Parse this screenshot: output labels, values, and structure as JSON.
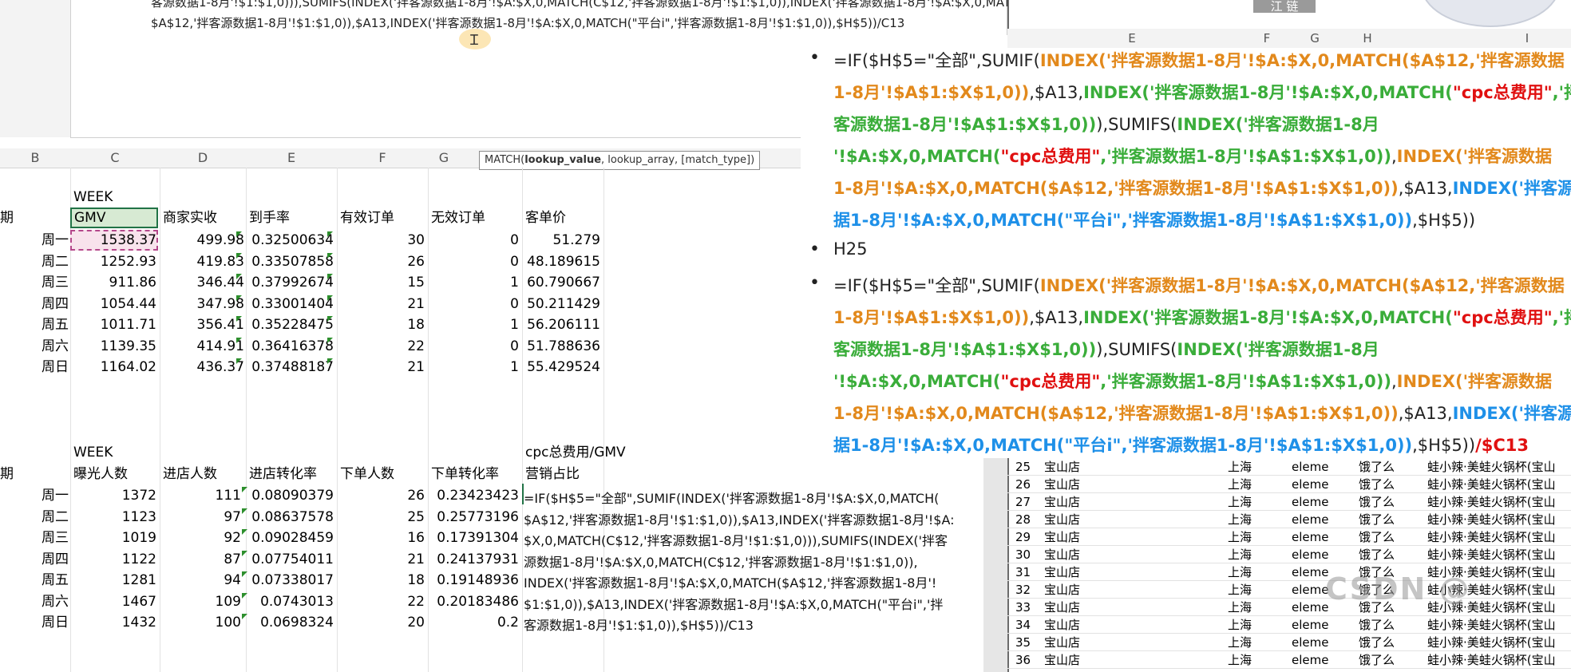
{
  "formula_bar": {
    "line1": "客源数据1-8月'!$1:$1,0))),SUMIFS(INDEX('拌客源数据1-8月'!$A:$X,0,MATCH(C$12,'拌客源数据1-8月'!$1:$1,0)),INDEX('拌客源数据1-8月'!$A:$X,0,MATCH(",
    "line2": "$A$12,'拌客源数据1-8月'!$1:$1,0)),$A13,INDEX('拌客源数据1-8月'!$A:$X,0,MATCH(\"平台i\",'拌客源数据1-8月'!$1:$1,0)),$H$5))/C13"
  },
  "tooltip": {
    "fn": "MATCH(",
    "arg1": "lookup_value",
    "rest": ", lookup_array, [match_type])"
  },
  "columns": [
    "B",
    "C",
    "D",
    "E",
    "F",
    "G"
  ],
  "top_table": {
    "week_label": "WEEK",
    "row_label_head": "期",
    "headers": [
      "GMV",
      "商家实收",
      "到手率",
      "有效订单",
      "无效订单",
      "客单价"
    ],
    "rows": [
      {
        "day": "周一",
        "vals": [
          "1538.37",
          "499.98",
          "0.32500634",
          "30",
          "0",
          "51.279"
        ]
      },
      {
        "day": "周二",
        "vals": [
          "1252.93",
          "419.83",
          "0.33507858",
          "26",
          "0",
          "48.189615"
        ]
      },
      {
        "day": "周三",
        "vals": [
          "911.86",
          "346.44",
          "0.37992674",
          "15",
          "1",
          "60.790667"
        ]
      },
      {
        "day": "周四",
        "vals": [
          "1054.44",
          "347.98",
          "0.33001404",
          "21",
          "0",
          "50.211429"
        ]
      },
      {
        "day": "周五",
        "vals": [
          "1011.71",
          "356.41",
          "0.35228475",
          "18",
          "1",
          "56.206111"
        ]
      },
      {
        "day": "周六",
        "vals": [
          "1139.35",
          "414.91",
          "0.36416378",
          "22",
          "0",
          "51.788636"
        ]
      },
      {
        "day": "周日",
        "vals": [
          "1164.02",
          "436.37",
          "0.37488187",
          "21",
          "1",
          "55.429524"
        ]
      }
    ]
  },
  "bottom_table": {
    "week_label": "WEEK",
    "extra_label": "cpc总费用/GMV",
    "row_label_head": "期",
    "headers": [
      "曝光人数",
      "进店人数",
      "进店转化率",
      "下单人数",
      "下单转化率",
      "营销占比"
    ],
    "rows": [
      {
        "day": "周一",
        "vals": [
          "1372",
          "111",
          "0.08090379",
          "26",
          "0.23423423"
        ]
      },
      {
        "day": "周二",
        "vals": [
          "1123",
          "97",
          "0.08637578",
          "25",
          "0.25773196"
        ]
      },
      {
        "day": "周三",
        "vals": [
          "1019",
          "92",
          "0.09028459",
          "16",
          "0.17391304"
        ]
      },
      {
        "day": "周四",
        "vals": [
          "1122",
          "87",
          "0.07754011",
          "21",
          "0.24137931"
        ]
      },
      {
        "day": "周五",
        "vals": [
          "1281",
          "94",
          "0.07338017",
          "18",
          "0.19148936"
        ]
      },
      {
        "day": "周六",
        "vals": [
          "1467",
          "109",
          "0.0743013",
          "22",
          "0.20183486"
        ]
      },
      {
        "day": "周日",
        "vals": [
          "1432",
          "100",
          "0.0698324",
          "20",
          "0.2"
        ]
      }
    ],
    "formula_lines": [
      "=IF($H$5=\"全部\",SUMIF(INDEX('拌客源数据1-8月'!$A:$X,0,MATCH(",
      "$A$12,'拌客源数据1-8月'!$1:$1,0)),$A13,INDEX('拌客源数据1-8月'!$A:",
      "$X,0,MATCH(C$12,'拌客源数据1-8月'!$1:$1,0))),SUMIFS(INDEX('拌客",
      "源数据1-8月'!$A:$X,0,MATCH(C$12,'拌客源数据1-8月'!$1:$1,0)),",
      "INDEX('拌客源数据1-8月'!$A:$X,0,MATCH($A$12,'拌客源数据1-8月'!",
      "$1:$1,0)),$A13,INDEX('拌客源数据1-8月'!$A:$X,0,MATCH(\"平台i\",'拌",
      "客源数据1-8月'!$1:$1,0)),$H$5))/C13"
    ]
  },
  "top_right": {
    "button_label": "江 链",
    "col_headers": [
      "E",
      "F",
      "G",
      "H",
      "I"
    ]
  },
  "right_panel": {
    "middle_item": "H25"
  },
  "bottom_right_rows": [
    {
      "n": "25",
      "store": "宝山店",
      "city": "上海",
      "platform": "eleme",
      "app": "饿了么",
      "item": "蛙小辣·美蛙火锅杯(宝山"
    },
    {
      "n": "26",
      "store": "宝山店",
      "city": "上海",
      "platform": "eleme",
      "app": "饿了么",
      "item": "蛙小辣·美蛙火锅杯(宝山"
    },
    {
      "n": "27",
      "store": "宝山店",
      "city": "上海",
      "platform": "eleme",
      "app": "饿了么",
      "item": "蛙小辣·美蛙火锅杯(宝山"
    },
    {
      "n": "28",
      "store": "宝山店",
      "city": "上海",
      "platform": "eleme",
      "app": "饿了么",
      "item": "蛙小辣·美蛙火锅杯(宝山"
    },
    {
      "n": "29",
      "store": "宝山店",
      "city": "上海",
      "platform": "eleme",
      "app": "饿了么",
      "item": "蛙小辣·美蛙火锅杯(宝山"
    },
    {
      "n": "30",
      "store": "宝山店",
      "city": "上海",
      "platform": "eleme",
      "app": "饿了么",
      "item": "蛙小辣·美蛙火锅杯(宝山"
    },
    {
      "n": "31",
      "store": "宝山店",
      "city": "上海",
      "platform": "eleme",
      "app": "饿了么",
      "item": "蛙小辣·美蛙火锅杯(宝山"
    },
    {
      "n": "32",
      "store": "宝山店",
      "city": "上海",
      "platform": "eleme",
      "app": "饿了么",
      "item": "蛙小辣·美蛙火锅杯(宝山"
    },
    {
      "n": "33",
      "store": "宝山店",
      "city": "上海",
      "platform": "eleme",
      "app": "饿了么",
      "item": "蛙小辣·美蛙火锅杯(宝山"
    },
    {
      "n": "34",
      "store": "宝山店",
      "city": "上海",
      "platform": "eleme",
      "app": "饿了么",
      "item": "蛙小辣·美蛙火锅杯(宝山"
    },
    {
      "n": "35",
      "store": "宝山店",
      "city": "上海",
      "platform": "eleme",
      "app": "饿了么",
      "item": "蛙小辣·美蛙火锅杯(宝山"
    },
    {
      "n": "36",
      "store": "宝山店",
      "city": "上海",
      "platform": "eleme",
      "app": "饿了么",
      "item": "蛙小辣·美蛙火锅杯(宝山"
    }
  ],
  "watermark": "CSDN @",
  "colors": {
    "orange": "#e2891c",
    "green": "#3aad3a",
    "blue": "#1e90e8",
    "red": "#e01010",
    "excel_green": "#217346"
  }
}
